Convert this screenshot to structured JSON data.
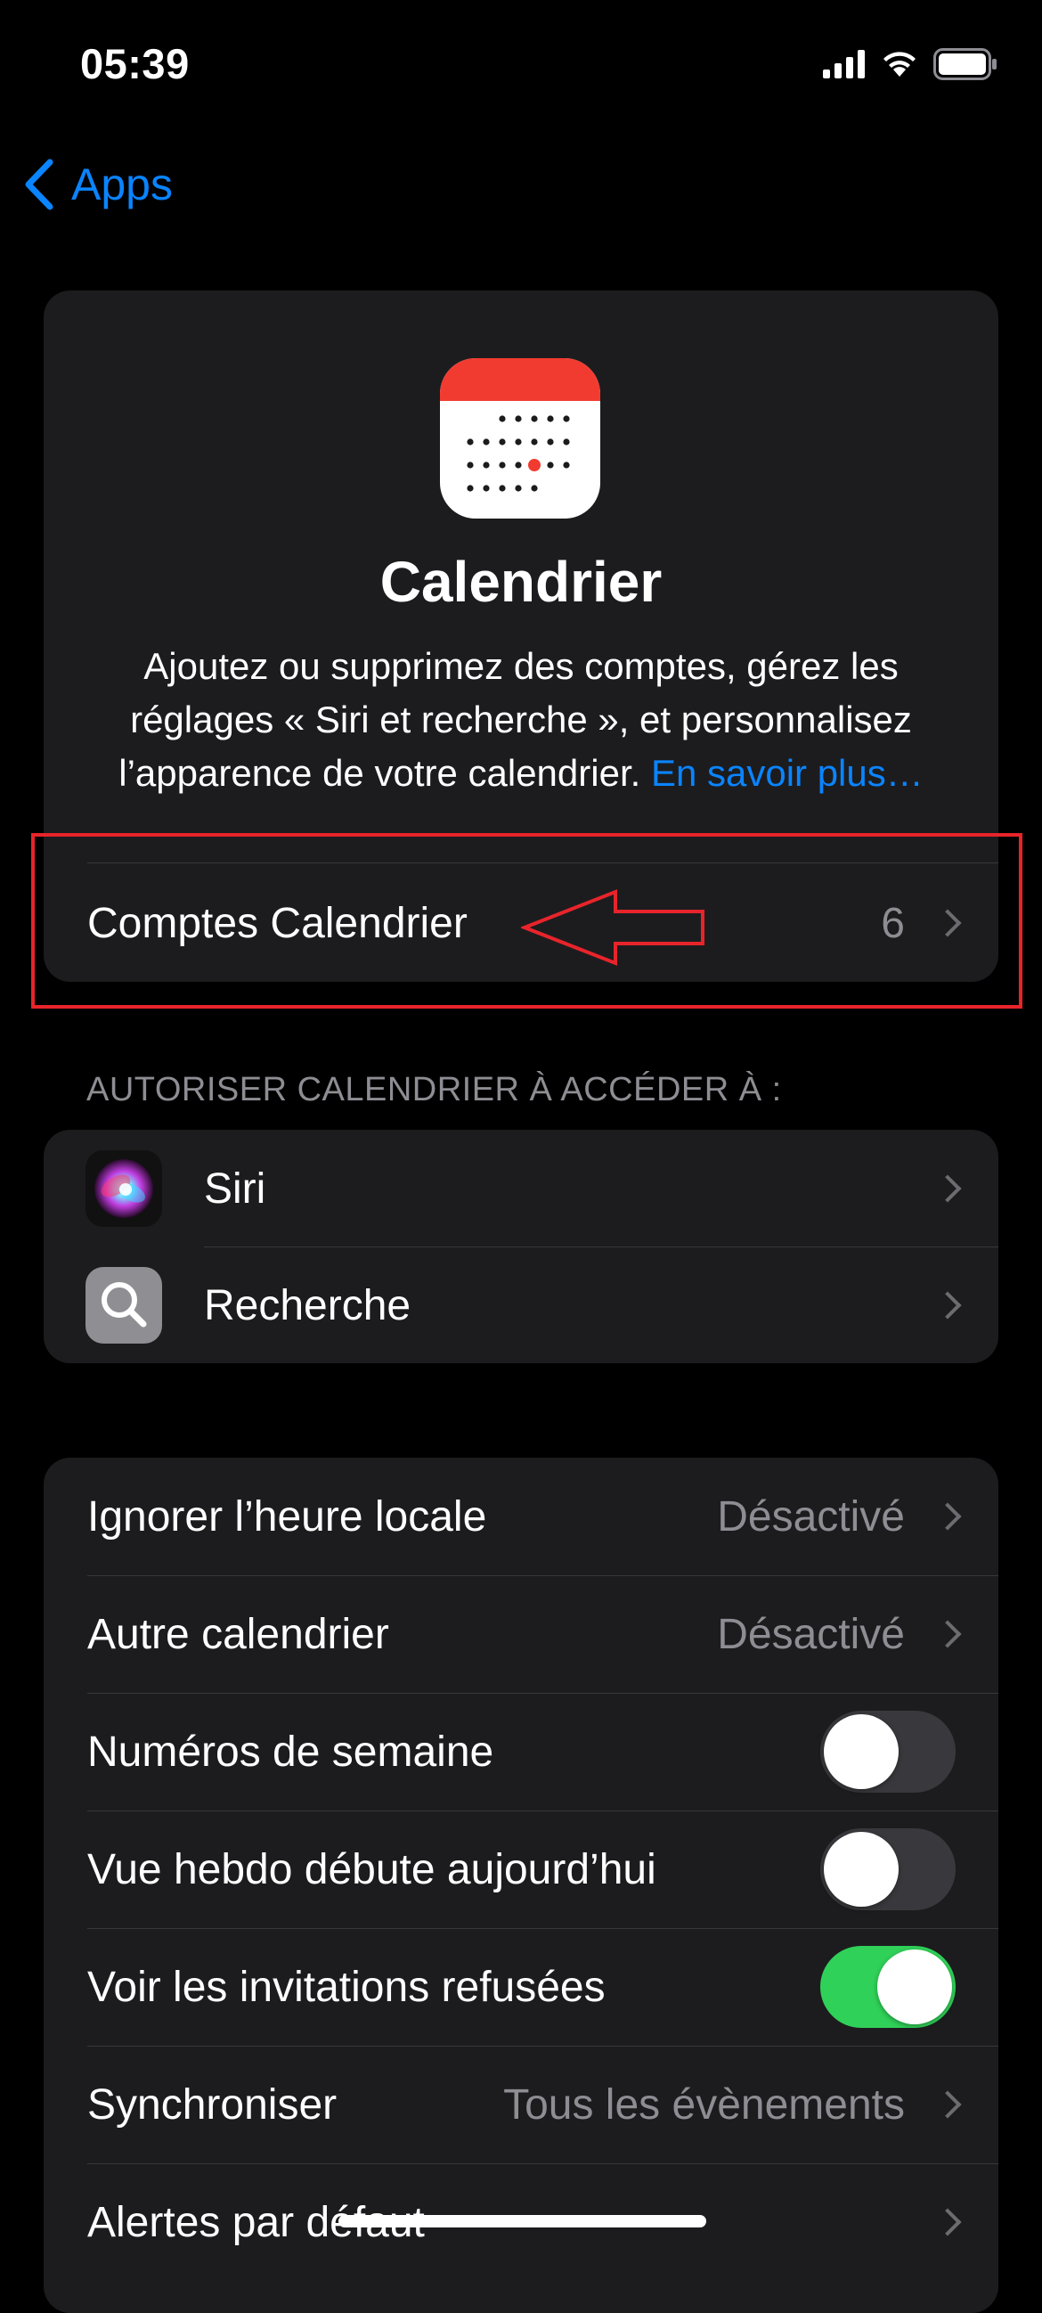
{
  "status_bar": {
    "time": "05:39"
  },
  "nav": {
    "back_label": "Apps"
  },
  "app_header": {
    "title": "Calendrier",
    "description": "Ajoutez ou supprimez des comptes, gérez les réglages « Siri et recherche », et personnalisez l’apparence de votre calendrier.",
    "link": "En savoir plus…",
    "icon": "calendar-app-icon"
  },
  "accounts": {
    "label": "Comptes Calendrier",
    "value": "6"
  },
  "access": {
    "header": "AUTORISER CALENDRIER À ACCÉDER À :",
    "items": [
      {
        "label": "Siri",
        "icon": "siri-icon"
      },
      {
        "label": "Recherche",
        "icon": "search-icon"
      }
    ]
  },
  "settings": {
    "items": [
      {
        "label": "Ignorer l’heure locale",
        "value": "Désactivé",
        "type": "disclosure"
      },
      {
        "label": "Autre calendrier",
        "value": "Désactivé",
        "type": "disclosure"
      },
      {
        "label": "Numéros de semaine",
        "type": "toggle",
        "on": false
      },
      {
        "label": "Vue hebdo débute aujourd’hui",
        "type": "toggle",
        "on": false
      },
      {
        "label": "Voir les invitations refusées",
        "type": "toggle",
        "on": true
      },
      {
        "label": "Synchroniser",
        "value": "Tous les évènements",
        "type": "disclosure"
      },
      {
        "label": "Alertes par défaut",
        "type": "disclosure"
      }
    ]
  },
  "colors": {
    "accent": "#0a84ff",
    "toggle_on": "#30d158",
    "annotation": "#e8242b",
    "calendar_red": "#f23b30"
  }
}
